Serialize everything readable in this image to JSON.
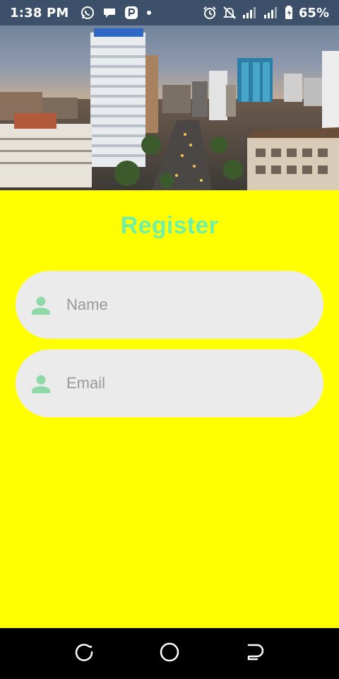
{
  "status_bar": {
    "time": "1:38 PM",
    "battery_percent": "65%",
    "left_icons": [
      "whatsapp-icon",
      "chat-bubble-icon",
      "app-notification-icon",
      "dot-icon"
    ],
    "right_icons": [
      "alarm-icon",
      "muted-bell-icon",
      "signal-icon",
      "signal-icon",
      "battery-icon"
    ]
  },
  "hero": {
    "image": "city skyline photo"
  },
  "form": {
    "title": "Register",
    "name_placeholder": "Name",
    "email_placeholder": "Email"
  },
  "colors": {
    "background": "#ffff00",
    "title": "#6ff0a6",
    "field_background": "#ebebeb",
    "field_icon": "#8fd9a8",
    "navbar": "#000000"
  },
  "nav_bar": {
    "buttons": [
      "recent-apps-icon",
      "home-icon",
      "back-icon"
    ]
  }
}
